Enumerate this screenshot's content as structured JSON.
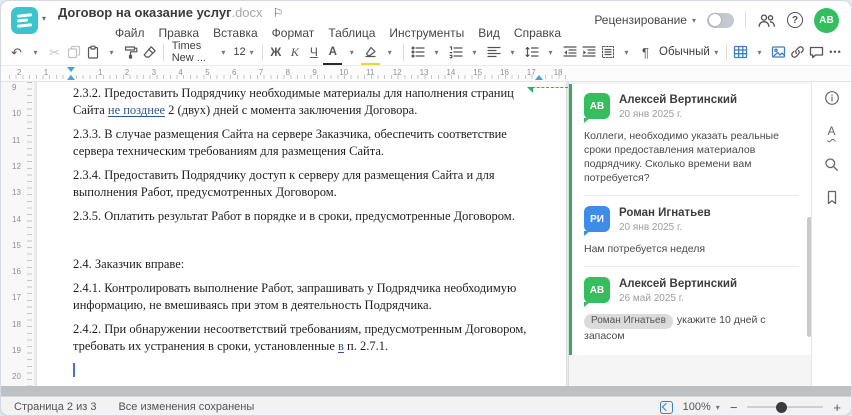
{
  "header": {
    "title": "Договор на оказание услуг",
    "title_ext": ".docx",
    "menu": [
      "Файл",
      "Правка",
      "Вставка",
      "Формат",
      "Таблица",
      "Инструменты",
      "Вид",
      "Справка"
    ],
    "review_label": "Рецензирование",
    "avatar_initials": "АВ"
  },
  "toolbar": {
    "font_name": "Times New ...",
    "font_size": "12",
    "bold": "Ж",
    "italic": "К",
    "underline": "Ч",
    "font_color_letter": "А",
    "highlight_letter": "",
    "paragraph_mark": "¶",
    "style_name": "Обычный"
  },
  "icons": {
    "logo_caret": "▾",
    "caret": "▾",
    "flag": "⚐",
    "undo": "↶",
    "cut": "✂",
    "more": "•••",
    "minus": "−",
    "plus": "+",
    "help": "?",
    "spellcheck_letter": "А"
  },
  "ruler": {
    "h_numbers": [
      "2",
      "1",
      "1",
      "2",
      "3",
      "4",
      "5",
      "6",
      "7",
      "8",
      "9",
      "10",
      "11",
      "12",
      "13",
      "14",
      "15",
      "16",
      "17",
      "18"
    ],
    "v_numbers": [
      "9",
      "10",
      "11",
      "12",
      "13",
      "14",
      "15",
      "16",
      "17",
      "18",
      "19",
      "20"
    ]
  },
  "document": {
    "p232_pre": "2.3.2. Предоставить Подрядчику необходимые материалы для наполнения страниц Сайта ",
    "p232_ins": "не позднее",
    "p232_post": " 2 (двух) дней с момента заключения Договора.",
    "p233": "2.3.3. В случае размещения Сайта на сервере Заказчика, обеспечить соответствие сервера техническим требованиям для размещения Сайта.",
    "p234": "2.3.4. Предоставить Подрядчику доступ к серверу для размещения Сайта и для выполнения Работ, предусмотренных Договором.",
    "p235": "2.3.5. Оплатить результат Работ в порядке и в сроки, предусмотренные Договором.",
    "p24": "2.4. Заказчик вправе:",
    "p241": "2.4.1. Контролировать выполнение Работ, запрашивать у Подрядчика необходимую информацию, не вмешиваясь при этом в деятельность Подрядчика.",
    "p242_pre": "2.4.2. При обнаружении несоответствий требованиям, предусмотренным Договором, требовать их устранения в сроки, установленные ",
    "p242_ins": "в",
    "p242_post": " п. 2.7.1."
  },
  "comments": {
    "items": [
      {
        "initials": "АВ",
        "name": "Алексей Вертинский",
        "date": "20 янв 2025 г.",
        "text": "Коллеги, необходимо указать реальные сроки предоставления материалов подрядчику. Сколько времени вам потребуется?"
      },
      {
        "initials": "РИ",
        "name": "Роман Игнатьев",
        "date": "20 янв 2025 г.",
        "text": "Нам потребуется неделя"
      },
      {
        "initials": "АВ",
        "name": "Алексей Вертинский",
        "date": "26 май 2025 г.",
        "mention": "Роман Игнатьев",
        "text": "укажите 10 дней с запасом"
      }
    ]
  },
  "status_bar": {
    "page_info": "Страница 2 из 3",
    "save_status": "Все изменения сохранены",
    "zoom_value": "100%"
  },
  "colors": {
    "logo_teal": "#3cc3ce",
    "avatar_green": "#33bf5e",
    "avatar_blue": "#3f8ce8",
    "accent_blue": "#3f7fbf",
    "comment_green": "#2fae5f",
    "insert_blue": "#2f5496",
    "highlight_yellow": "#f2d230",
    "marker_blue": "#49a0dc",
    "cursor_blue": "#4a6fd4"
  }
}
